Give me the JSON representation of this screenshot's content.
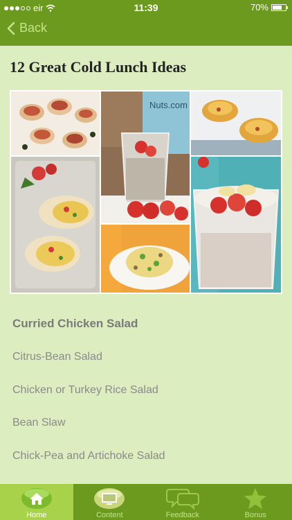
{
  "status_bar": {
    "carrier": "eir",
    "time": "11:39",
    "battery": "70%",
    "battery_level": 0.7
  },
  "nav": {
    "back_label": "Back"
  },
  "page": {
    "title": "12 Great Cold Lunch Ideas"
  },
  "hero_image": {
    "tiles": [
      "Nuts.com"
    ]
  },
  "items": [
    {
      "label": "Curried Chicken Salad"
    },
    {
      "label": "Citrus-Bean Salad"
    },
    {
      "label": "Chicken or Turkey Rice Salad"
    },
    {
      "label": "Bean Slaw"
    },
    {
      "label": "Chick-Pea and Artichoke Salad"
    }
  ],
  "tabs": [
    {
      "label": "Home",
      "icon": "home-icon",
      "active": true
    },
    {
      "label": "Content",
      "icon": "monitor-icon",
      "active": false
    },
    {
      "label": "Feedback",
      "icon": "chat-bubbles-icon",
      "active": false
    },
    {
      "label": "Bonus",
      "icon": "star-icon",
      "active": false
    }
  ],
  "colors": {
    "brand": "#6b9a1e",
    "active_tab": "#a8d24a",
    "background": "#dcedc0"
  }
}
